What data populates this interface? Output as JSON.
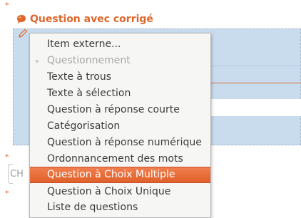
{
  "colors": {
    "accent": "#e0662b",
    "selection_blue": "#c9dcee",
    "menu_highlight": "#e96a36"
  },
  "panel": {
    "title": "Question avec corrigé",
    "title_icon": "speech-bubble-icon",
    "edit_icon": "pencil-icon",
    "required_mark": "*"
  },
  "field": {
    "placeholder": "CH"
  },
  "menu": {
    "items": [
      {
        "label": "Item externe...",
        "state": "normal"
      },
      {
        "label": "Questionnement",
        "state": "disabled"
      },
      {
        "label": "Texte à trous",
        "state": "normal"
      },
      {
        "label": "Texte à sélection",
        "state": "normal"
      },
      {
        "label": "Question à réponse courte",
        "state": "normal"
      },
      {
        "label": "Catégorisation",
        "state": "normal"
      },
      {
        "label": "Question à réponse numérique",
        "state": "normal"
      },
      {
        "label": "Ordonnancement des mots",
        "state": "normal"
      },
      {
        "label": "Question à Choix Multiple",
        "state": "active"
      },
      {
        "label": "Question à Choix Unique",
        "state": "normal"
      },
      {
        "label": "Liste de questions",
        "state": "normal"
      }
    ]
  }
}
